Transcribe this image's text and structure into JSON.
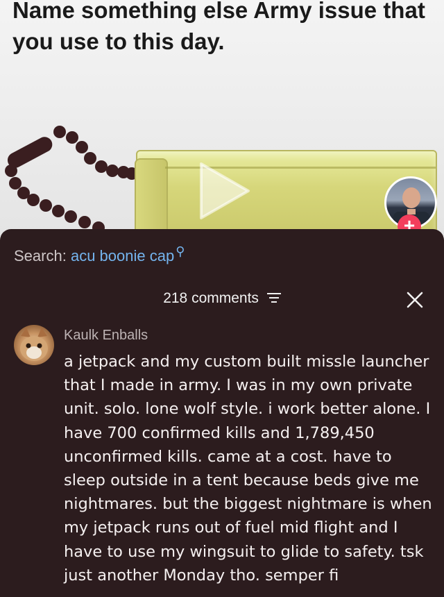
{
  "video": {
    "caption": "Name something else Army issue that you use to this day."
  },
  "comments_panel": {
    "search_label": "Search:",
    "search_term": "acu boonie cap",
    "comment_count": "218 comments",
    "comments": [
      {
        "username": "Kaulk Enballs",
        "text": "a jetpack and my custom built missle launcher that I made in army. I was in my own private unit. solo. lone wolf style. i work better alone. I have 700 confirmed kills and 1,789,450 unconfirmed kills. came at a cost. have to sleep outside in a tent because beds give me nightmares. but the biggest nightmare is when my jetpack runs out of fuel mid flight and I have to use my wingsuit to glide to safety. tsk just another Monday tho. semper fi"
      }
    ]
  },
  "colors": {
    "sheet_background": "#2c1c1e",
    "search_term": "#74b4ee",
    "follow_button": "#f33e5c"
  },
  "icons": [
    "play-icon",
    "follow-plus-icon",
    "search-icon",
    "filter-icon",
    "close-icon"
  ]
}
